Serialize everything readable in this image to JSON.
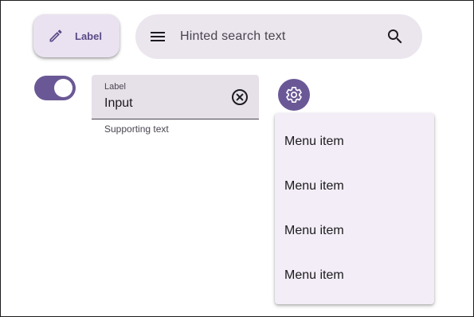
{
  "fab": {
    "label": "Label",
    "icon": "pencil-icon"
  },
  "search": {
    "hint": "Hinted search text",
    "leading_icon": "menu-icon",
    "trailing_icon": "search-icon"
  },
  "switch": {
    "state": "on"
  },
  "textfield": {
    "label": "Label",
    "value": "Input",
    "supporting_text": "Supporting text",
    "trailing_icon": "clear-icon"
  },
  "settings_button": {
    "icon": "gear-icon"
  },
  "menu": {
    "items": [
      {
        "label": "Menu item"
      },
      {
        "label": "Menu item"
      },
      {
        "label": "Menu item"
      },
      {
        "label": "Menu item"
      }
    ]
  },
  "colors": {
    "primary": "#6a5896",
    "surface_container": "#ebe5ee",
    "menu_surface": "#f2edf6",
    "on_surface": "#1c1b1f",
    "on_surface_variant": "#49454f"
  }
}
